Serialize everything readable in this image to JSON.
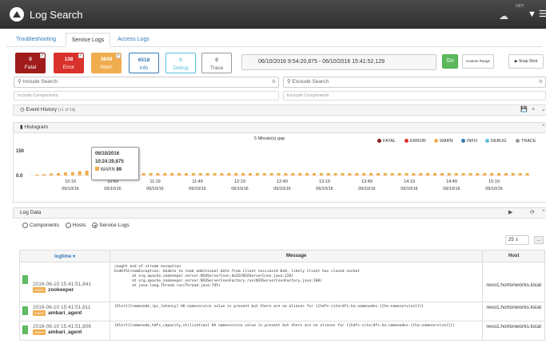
{
  "header": {
    "title": "Log Search",
    "odt": "ODT",
    "icons": [
      "logo-icon",
      "world-map-icon",
      "filter-icon",
      "menu-icon"
    ]
  },
  "tabs": [
    {
      "label": "Troubleshooting"
    },
    {
      "label": "Service Logs"
    },
    {
      "label": "Access Logs"
    }
  ],
  "levels": [
    {
      "count": "0",
      "label": "Fatal",
      "color": "#a01c1c",
      "checked": true
    },
    {
      "count": "138",
      "label": "Error",
      "color": "#d9312b",
      "checked": true
    },
    {
      "count": "3849",
      "label": "Warn",
      "color": "#f0ad4e",
      "checked": true
    },
    {
      "count": "6518",
      "label": "Info",
      "color": "#ffffff",
      "checked": false
    },
    {
      "count": "0",
      "label": "Debug",
      "color": "#ffffff",
      "checked": false
    },
    {
      "count": "0",
      "label": "Trace",
      "color": "#ffffff",
      "checked": false
    }
  ],
  "date_range": "06/10/2016 9:54:20,875 - 06/10/2016 15:41:52,129",
  "buttons": {
    "go": "Go",
    "custom_range": "Custom Range",
    "snapshot": "Snap Shot"
  },
  "search": {
    "include": "Include Search",
    "exclude": "Exclude Search"
  },
  "components": {
    "include": "Include Components",
    "exclude": "Exclude Components"
  },
  "event_history": {
    "label": "Event History",
    "count": "[+1 of 1d]"
  },
  "histogram": {
    "title": "Histogram",
    "gap": "5 Minute(s) gap"
  },
  "tooltip": {
    "date": "06/10/2016",
    "time": "10:24:20,875",
    "level": "WARN",
    "value": "89"
  },
  "chart_data": {
    "type": "bar",
    "stacked": true,
    "ylim": [
      0,
      150
    ],
    "yticks": [
      "150",
      "0.0"
    ],
    "xticks": [
      {
        "time": "10:19",
        "date": "06/10/16"
      },
      {
        "time": "10:49",
        "date": "06/10/16"
      },
      {
        "time": "11:19",
        "date": "06/10/16"
      },
      {
        "time": "11:49",
        "date": "06/10/16"
      },
      {
        "time": "12:19",
        "date": "06/10/16"
      },
      {
        "time": "12:49",
        "date": "06/10/16"
      },
      {
        "time": "13:19",
        "date": "06/10/16"
      },
      {
        "time": "13:49",
        "date": "06/10/16"
      },
      {
        "time": "14:19",
        "date": "06/10/16"
      },
      {
        "time": "14:49",
        "date": "06/10/16"
      },
      {
        "time": "15:19",
        "date": "06/10/16"
      }
    ],
    "legend": [
      {
        "name": "FATAL",
        "color": "#8b1a1a"
      },
      {
        "name": "ERROR",
        "color": "#d9312b"
      },
      {
        "name": "WARN",
        "color": "#f0ad4e"
      },
      {
        "name": "INFO",
        "color": "#337ab7"
      },
      {
        "name": "DEBUG",
        "color": "#5bc0de"
      },
      {
        "name": "TRACE",
        "color": "#999999"
      }
    ],
    "warn": [
      6,
      8,
      12,
      14,
      18,
      20,
      25,
      28,
      40,
      55,
      70,
      89,
      15,
      14,
      13,
      14,
      14,
      14,
      14,
      14,
      14,
      14,
      14,
      14,
      14,
      14,
      14,
      14,
      14,
      14,
      14,
      14,
      14,
      14,
      14,
      14,
      14,
      14,
      14,
      14,
      14,
      14,
      14,
      14,
      14,
      14,
      14,
      14,
      14,
      14,
      14,
      14,
      14,
      14,
      14,
      14,
      14,
      14,
      14,
      14,
      14,
      14,
      14,
      14,
      14,
      14,
      14,
      14,
      14,
      14
    ],
    "error": [
      0,
      0,
      0,
      0,
      0,
      0,
      0,
      0,
      3,
      4,
      6,
      8,
      0,
      0,
      0,
      0,
      0,
      0,
      0,
      0,
      0,
      0,
      0,
      0,
      0,
      0,
      0,
      0,
      0,
      0,
      0,
      0,
      0,
      0,
      0,
      0,
      0,
      0,
      0,
      0,
      0,
      0,
      0,
      0,
      0,
      0,
      0,
      0,
      0,
      0,
      0,
      0,
      0,
      0,
      0,
      0,
      0,
      0,
      0,
      0,
      0,
      0,
      0,
      0,
      0,
      0,
      0,
      0,
      0,
      0
    ]
  },
  "log_data": {
    "title": "Log Data",
    "view_options": [
      {
        "label": "Components",
        "selected": false
      },
      {
        "label": "Hosts",
        "selected": false
      },
      {
        "label": "Service Logs",
        "selected": true
      }
    ],
    "page_size": "25",
    "columns": [
      "logtime",
      "Message",
      "Host"
    ],
    "rows": [
      {
        "time": "2016-06-10 15:41:51,841",
        "level": "WARN",
        "component": "zookeeper",
        "message": "caught end of stream exception\nEndOfStreamException: Unable to read additional data from client sessionid 0x0, likely client has closed socket\n        at org.apache.zookeeper.server.NIOServerCnxn.doIO(NIOServerCnxn.java:228)\n        at org.apache.zookeeper.server.NIOServerCnxnFactory.run(NIOServerCnxnFactory.java:208)\n        at java.lang.Thread.run(Thread.java:745)",
        "host": "revo1.hortonworks.local"
      },
      {
        "time": "2016-06-10 15:41:51,811",
        "level": "WARN",
        "component": "ambari_agent",
        "message": "[Alert][namenode_rpc_latency] HA nameservice value is present but there are no aliases for {{hdfs-site/dfs.ha.namenodes.{{ha-nameservice}}}}",
        "host": "revo1.hortonworks.local"
      },
      {
        "time": "2016-06-10 15:41:51,806",
        "level": "WARN",
        "component": "ambari_agent",
        "message": "[Alert][namenode_hdfs_capacity_utilization] HA nameservice value is present but there are no aliases for {{hdfs-site/dfs.ha.namenodes.{{ha-nameservice}}}}",
        "host": "revo1.hortonworks.local"
      }
    ]
  }
}
